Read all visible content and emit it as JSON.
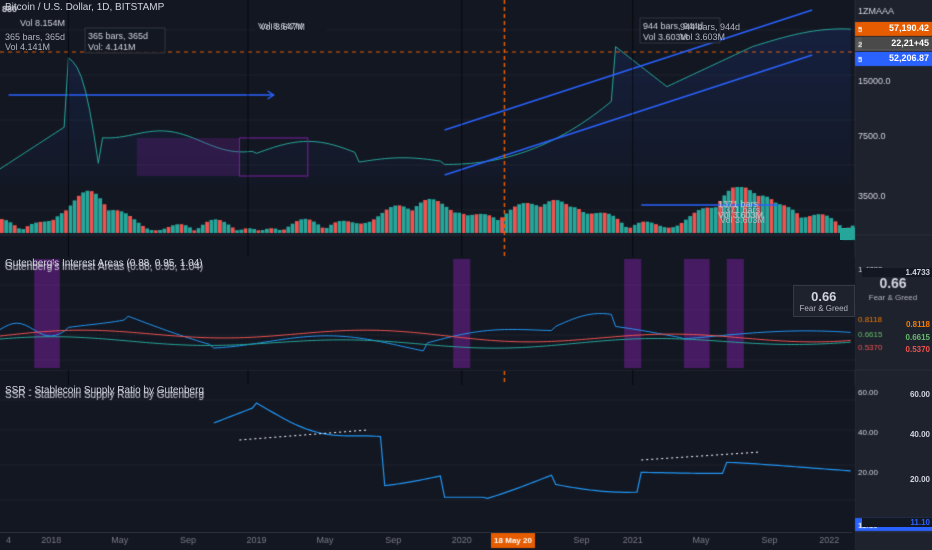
{
  "chart": {
    "title": "Bitcoin / U.S. Dollar, 1D, BITSTAMP",
    "exchange": "BITSTAMP",
    "timeframe": "1D",
    "asset": "Bitcoin"
  },
  "prices": {
    "current": "57,190.42",
    "level1": "22,21+45",
    "level2": "52,206.87",
    "level3": "1ZMAAA",
    "high": "880",
    "vol_8154m": "Vol 8.154M",
    "vol_4141m": "Vol 4.141M",
    "vol_8647m": "Vol 8.647M",
    "vol_3603m1": "Vol 3.603M",
    "vol_3603m2": "Vol 3.603M",
    "bars_365": "365 bars, 365d",
    "bars_944": "944 bars, 944d",
    "bars_1371": "1371 bars"
  },
  "right_labels": {
    "main_chart": [
      "1ZMAAA",
      "15000.0",
      "7500.0",
      "3500.0"
    ],
    "fear_greed": {
      "value": "0.66",
      "label": "Fear & Greed",
      "val1": "1.4733",
      "val2": "0.8118",
      "val3": "0.6615",
      "val4": "0.5370"
    },
    "ssr": {
      "val1": "60.00",
      "val2": "40.00",
      "val3": "20.00",
      "val4": "11.10"
    }
  },
  "indicators": {
    "gutenberg": "Gutenberg&#039;s Interest Areas (0.88, 0.95, 1.04)",
    "ssr": "SSR - Stablecoin Supply Ratio by Gutenberg"
  },
  "time_labels": [
    {
      "label": "4",
      "left_pct": 1
    },
    {
      "label": "2018",
      "left_pct": 6
    },
    {
      "label": "May",
      "left_pct": 14
    },
    {
      "label": "Sep",
      "left_pct": 22
    },
    {
      "label": "2019",
      "left_pct": 30
    },
    {
      "label": "May",
      "left_pct": 38
    },
    {
      "label": "Sep",
      "left_pct": 46
    },
    {
      "label": "2020",
      "left_pct": 54
    },
    {
      "label": "18 May 20",
      "left_pct": 60,
      "highlight": true
    },
    {
      "label": "Sep",
      "left_pct": 68
    },
    {
      "label": "2021",
      "left_pct": 74
    },
    {
      "label": "May",
      "left_pct": 82
    },
    {
      "label": "Sep",
      "left_pct": 90
    },
    {
      "label": "2022",
      "left_pct": 97
    }
  ],
  "colors": {
    "bg": "#131722",
    "panel_bg": "#1e222d",
    "border": "#2a2e39",
    "text": "#d1d4dc",
    "orange": "#e65c00",
    "blue": "#2962ff",
    "green": "#26a69a",
    "red": "#ef5350",
    "purple": "#7b1fa2",
    "cyan": "#00bcd4"
  }
}
